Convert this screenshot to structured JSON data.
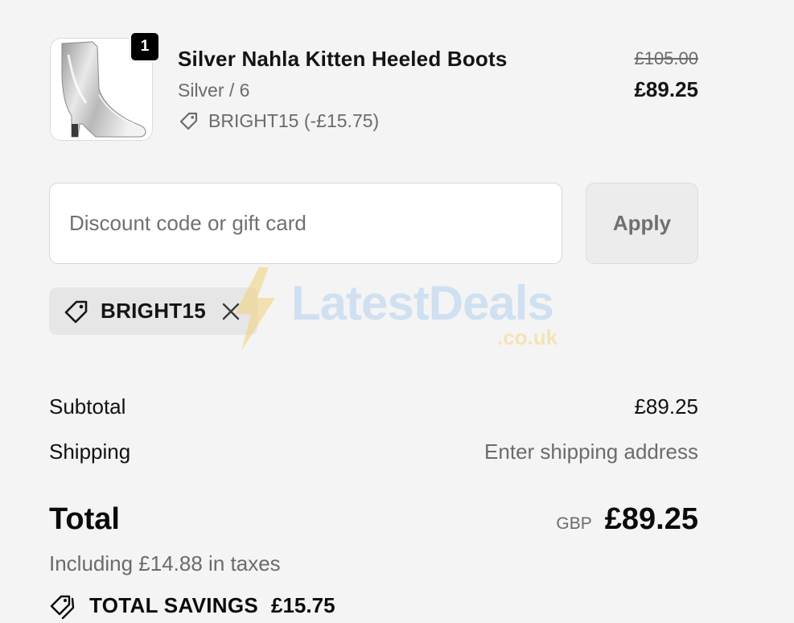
{
  "line_item": {
    "quantity": "1",
    "title": "Silver Nahla Kitten Heeled Boots",
    "variant": "Silver / 6",
    "discount": "BRIGHT15 (-£15.75)",
    "original_price": "£105.00",
    "price": "£89.25",
    "image_icon": "silver-boot-image"
  },
  "discount_form": {
    "placeholder": "Discount code or gift card",
    "apply_label": "Apply"
  },
  "applied_code": {
    "code": "BRIGHT15",
    "icon": "tag-icon",
    "remove_icon": "close-icon"
  },
  "watermark": {
    "brand": "LatestDeals",
    "domain": ".co.uk"
  },
  "summary": {
    "subtotal_label": "Subtotal",
    "subtotal_value": "£89.25",
    "shipping_label": "Shipping",
    "shipping_value": "Enter shipping address",
    "total_label": "Total",
    "currency": "GBP",
    "total_value": "£89.25",
    "taxes_note": "Including £14.88 in taxes",
    "savings_label": "TOTAL SAVINGS",
    "savings_value": "£15.75"
  },
  "colors": {
    "background": "#f4f4f4",
    "text": "#0b0b0b",
    "muted": "#6b6b6b",
    "badge": "#000000"
  }
}
